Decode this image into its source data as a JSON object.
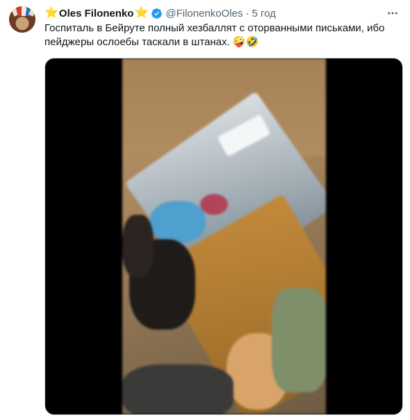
{
  "tweet": {
    "star_before": "⭐",
    "author_name": "Oles Filonenko",
    "star_after": "⭐",
    "handle": "@FilonenkoOles",
    "separator": "·",
    "time": "5 год",
    "text": "Госпиталь в Бейруте полный хезбаллят с оторванными письками, ибо пейджеры ослоебы таскали в штанах.",
    "emojis": "🤪🤣"
  },
  "icons": {
    "verified": "verified-badge-icon",
    "more": "more-options-icon",
    "avatar": "avatar"
  },
  "colors": {
    "text": "#0f1419",
    "secondary": "#536471",
    "verified": "#1d9bf0",
    "media_background": "#000000"
  }
}
